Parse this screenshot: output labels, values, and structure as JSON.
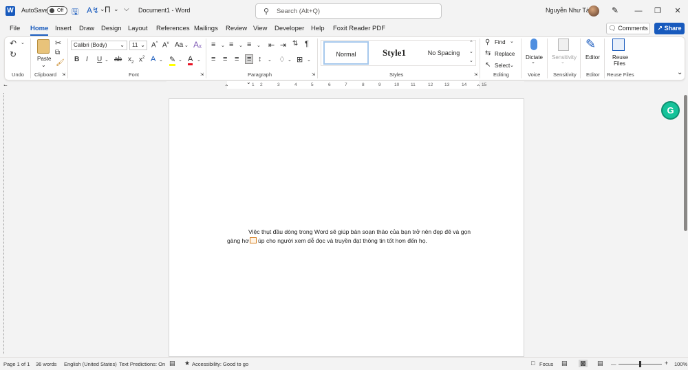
{
  "titlebar": {
    "autosave_label": "AutoSave",
    "autosave_state": "Off",
    "document_title": "Document1  -  Word",
    "search_placeholder": "Search (Alt+Q)",
    "user_name": "Nguyễn Như Tài"
  },
  "menu": {
    "tabs": [
      "File",
      "Home",
      "Insert",
      "Draw",
      "Design",
      "Layout",
      "References",
      "Mailings",
      "Review",
      "View",
      "Developer",
      "Help",
      "Foxit Reader PDF"
    ],
    "active": "Home",
    "comments_label": "Comments",
    "share_label": "Share"
  },
  "ribbon": {
    "undo_group": "Undo",
    "clipboard_group": "Clipboard",
    "paste_label": "Paste",
    "font_group": "Font",
    "font_name": "Calibri (Body)",
    "font_size": "11",
    "paragraph_group": "Paragraph",
    "styles_group": "Styles",
    "styles": [
      "Normal",
      "Style1",
      "No Spacing"
    ],
    "editing_group": "Editing",
    "find_label": "Find",
    "replace_label": "Replace",
    "select_label": "Select",
    "voice_group": "Voice",
    "dictate_label": "Dictate",
    "sensitivity_group": "Sensitivity",
    "sensitivity_label": "Sensitivity",
    "editor_group": "Editor",
    "editor_label": "Editor",
    "reuse_group": "Reuse Files",
    "reuse_label_1": "Reuse",
    "reuse_label_2": "Files"
  },
  "ruler": {
    "numbers": [
      "1",
      "2",
      "3",
      "4",
      "5",
      "6",
      "7",
      "8",
      "9",
      "10",
      "11",
      "12",
      "13",
      "14",
      "15"
    ]
  },
  "document": {
    "line1": "Việc thụt đầu dòng trong Word sẽ giúp bản soạn thảo của bạn trở nên đẹp đẽ và gọn",
    "line2_a": "gàng hơ",
    "line2_b": "úp cho người xem dễ đọc và truyền đạt thông tin tốt hơn đến họ."
  },
  "statusbar": {
    "page": "Page 1 of 1",
    "words": "36 words",
    "language": "English (United States)",
    "predictions": "Text Predictions: On",
    "accessibility": "Accessibility: Good to go",
    "focus": "Focus",
    "zoom": "100%"
  },
  "colors": {
    "accent": "#185abd",
    "grammarly": "#15c39a"
  }
}
